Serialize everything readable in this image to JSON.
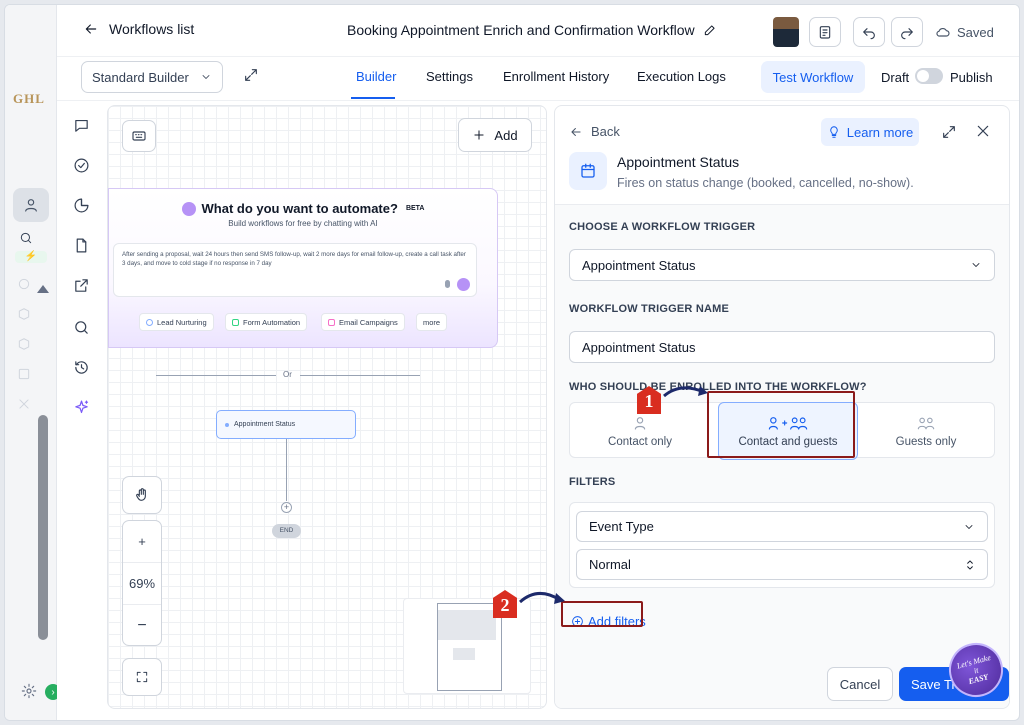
{
  "brand": {
    "logo_text": "GHL",
    "accent": "#155eef"
  },
  "header": {
    "back_label": "Workflows list",
    "title": "Booking Appointment Enrich and Confirmation Workflow",
    "saved_label": "Saved"
  },
  "subnav": {
    "builder_mode": "Standard Builder",
    "tabs": [
      {
        "label": "Builder"
      },
      {
        "label": "Settings"
      },
      {
        "label": "Enrollment History"
      },
      {
        "label": "Execution Logs"
      }
    ],
    "test_label": "Test Workflow",
    "draft_label": "Draft",
    "publish_label": "Publish"
  },
  "canvas": {
    "add_label": "Add",
    "ai": {
      "title": "What do you want to automate?",
      "badge": "BETA",
      "subtitle": "Build workflows for free by chatting with AI",
      "prompt": "After sending a proposal, wait 24 hours then send SMS follow-up, wait 2 more days for email follow-up, create a call task after 3 days, and move to cold stage if no response in 7 day",
      "chips": [
        {
          "label": "Lead Nurturing",
          "color": "#84adff"
        },
        {
          "label": "Form Automation",
          "color": "#32d583"
        },
        {
          "label": "Email Campaigns",
          "color": "#f670c7"
        },
        {
          "label": "more",
          "color": ""
        }
      ]
    },
    "or_label": "Or",
    "trigger_node": "Appointment Status",
    "end_label": "END",
    "zoom_in": "+",
    "zoom_level": "69%",
    "zoom_out": "−"
  },
  "panel": {
    "back_label": "Back",
    "learn_label": "Learn more",
    "trigger_name": "Appointment Status",
    "trigger_desc": "Fires on status change (booked, cancelled, no-show).",
    "choose_label": "CHOOSE A WORKFLOW TRIGGER",
    "trigger_value": "Appointment Status",
    "name_label": "WORKFLOW TRIGGER NAME",
    "name_value": "Appointment Status",
    "enroll_label": "WHO SHOULD BE ENROLLED INTO THE WORKFLOW?",
    "enroll_options": [
      {
        "label": "Contact only"
      },
      {
        "label": "Contact and guests"
      },
      {
        "label": "Guests only"
      }
    ],
    "filters_label": "FILTERS",
    "filter_field": "Event Type",
    "filter_value": "Normal",
    "add_filters_label": "Add filters",
    "cancel_label": "Cancel",
    "save_label": "Save Ti"
  },
  "annotations": {
    "step1": "1",
    "step2": "2",
    "color": "#8b1a1a"
  },
  "watermark": {
    "line1": "Let's Make",
    "line2": "it",
    "line3": "EASY"
  }
}
